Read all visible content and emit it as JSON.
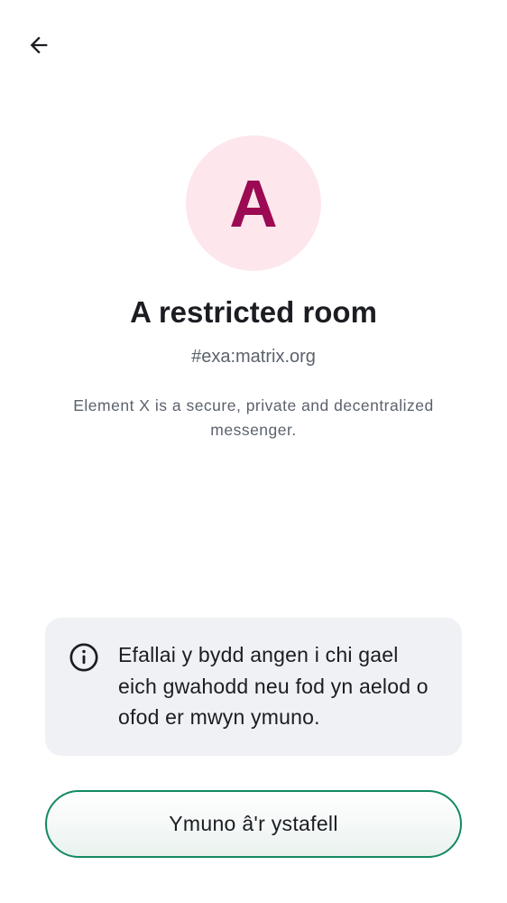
{
  "toolbar": {
    "back_icon": "arrow-left-icon"
  },
  "room": {
    "avatar_letter": "A",
    "avatar_bg": "#fde6ec",
    "avatar_fg": "#9b0a52",
    "name": "A restricted room",
    "alias": "#exa:matrix.org",
    "topic": "Element X is a secure, private and decentralized messenger."
  },
  "notice": {
    "icon": "info-icon",
    "text": "Efallai y bydd angen i chi gael eich gwahodd neu fod yn aelod o ofod er mwyn ymuno."
  },
  "actions": {
    "join_label": "Ymuno â'r ystafell",
    "accent": "#138a60"
  }
}
